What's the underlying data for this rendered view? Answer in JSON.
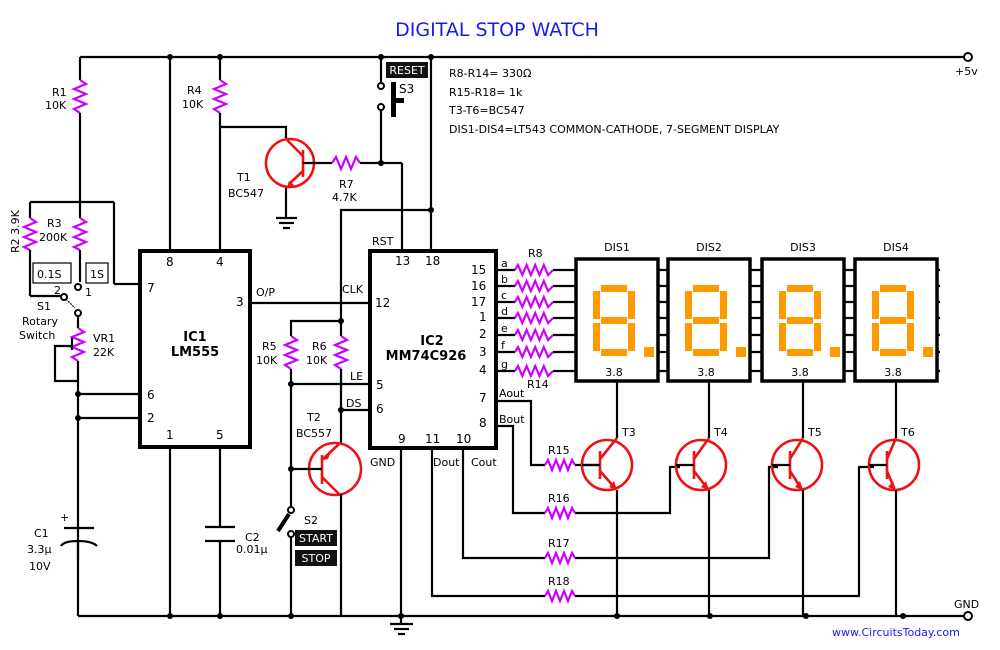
{
  "title": "DIGITAL STOP WATCH",
  "notes": [
    "R8-R14= 330Ω",
    "R15-R18= 1k",
    "T3-T6=BC547",
    "DIS1-DIS4=LT543 COMMON-CATHODE, 7-SEGMENT DISPLAY"
  ],
  "rails": {
    "vcc": "+5v",
    "gnd": "GND"
  },
  "website": "www.CircuitsToday.com",
  "colors": {
    "title": "#1a1aee",
    "resistor": "#cc00ff",
    "transistor": "#ee1111",
    "segment": "#ff9900"
  },
  "components": {
    "R1": {
      "name": "R1",
      "value": "10K"
    },
    "R2": {
      "name": "R2",
      "value": "3.9K",
      "label": "R2 3.9K"
    },
    "R3": {
      "name": "R3",
      "value": "200K"
    },
    "R4": {
      "name": "R4",
      "value": "10K"
    },
    "R5": {
      "name": "R5",
      "value": "10K"
    },
    "R6": {
      "name": "R6",
      "value": "10K"
    },
    "R7": {
      "name": "R7",
      "value": "4.7K"
    },
    "R8": {
      "name": "R8"
    },
    "R14": {
      "name": "R14"
    },
    "R15": {
      "name": "R15"
    },
    "R16": {
      "name": "R16"
    },
    "R17": {
      "name": "R17"
    },
    "R18": {
      "name": "R18"
    },
    "VR1": {
      "name": "VR1",
      "value": "22K"
    },
    "C1": {
      "name": "C1",
      "value": "3.3μ",
      "voltage": "10V",
      "polarity": "+"
    },
    "C2": {
      "name": "C2",
      "value": "0.01μ"
    },
    "T1": {
      "name": "T1",
      "type": "BC547"
    },
    "T2": {
      "name": "T2",
      "type": "BC557"
    },
    "T3": {
      "name": "T3"
    },
    "T4": {
      "name": "T4"
    },
    "T5": {
      "name": "T5"
    },
    "T6": {
      "name": "T6"
    },
    "S1": {
      "name": "S1",
      "desc1": "Rotary",
      "desc2": "Switch",
      "pos1": "1",
      "pos2": "2",
      "range1": "1S",
      "range2": "0.1S"
    },
    "S2": {
      "name": "S2",
      "btn1": "START",
      "btn2": "STOP"
    },
    "S3": {
      "name": "S3",
      "btn": "RESET"
    }
  },
  "ic1": {
    "name": "IC1",
    "part": "LM555",
    "pins": {
      "p8": "8",
      "p4": "4",
      "p7": "7",
      "p3": "3",
      "p6": "6",
      "p2": "2",
      "p1": "1",
      "p5": "5"
    },
    "out_label": "O/P"
  },
  "ic2": {
    "name": "IC2",
    "part": "MM74C926",
    "pins": {
      "p13": "13",
      "p18": "18",
      "p12": "12",
      "p5": "5",
      "p6": "6",
      "p9": "9",
      "p11": "11",
      "p10": "10",
      "p15": "15",
      "p16": "16",
      "p17": "17",
      "p1": "1",
      "p2": "2",
      "p3": "3",
      "p4": "4",
      "p7": "7",
      "p8": "8"
    },
    "signals": {
      "rst": "RST",
      "clk": "CLK",
      "le": "LE",
      "ds": "DS",
      "gnd": "GND",
      "dout": "Dout",
      "cout": "Cout",
      "aout": "Aout",
      "bout": "Bout"
    },
    "segments": [
      "a",
      "b",
      "c",
      "d",
      "e",
      "f",
      "g"
    ]
  },
  "displays": [
    {
      "name": "DIS1",
      "pins": "3.8"
    },
    {
      "name": "DIS2",
      "pins": "3.8"
    },
    {
      "name": "DIS3",
      "pins": "3.8"
    },
    {
      "name": "DIS4",
      "pins": "3.8"
    }
  ]
}
